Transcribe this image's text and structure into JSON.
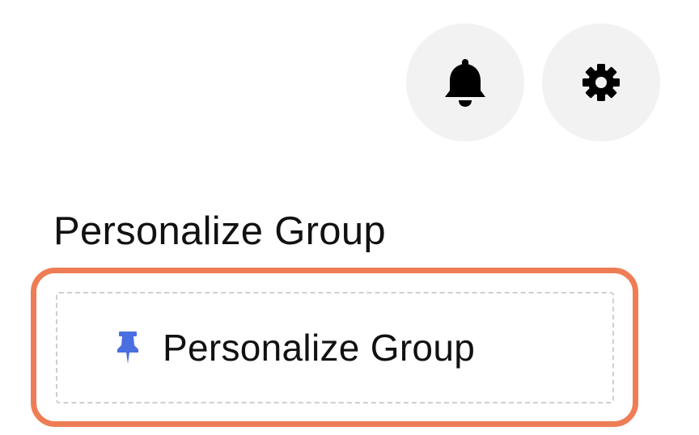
{
  "header": {
    "notifications": {
      "icon": "bell-icon"
    },
    "settings": {
      "icon": "gear-icon"
    }
  },
  "section": {
    "title": "Personalize Group"
  },
  "group_item": {
    "icon": "pin-icon",
    "label": "Personalize Group"
  },
  "colors": {
    "highlight_border": "#ee7d55",
    "pin_icon": "#4a6fe0",
    "icon_button_bg": "#f2f2f2",
    "dashed_border": "#cfcfcf"
  }
}
